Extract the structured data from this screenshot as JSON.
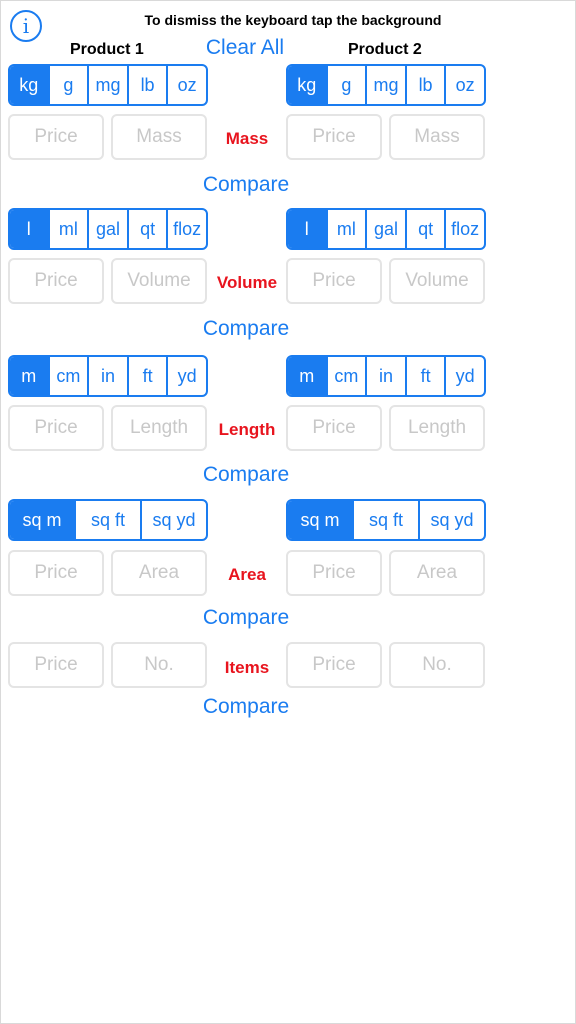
{
  "header": {
    "info_icon_glyph": "i",
    "hint": "To dismiss the keyboard tap the background",
    "product1": "Product 1",
    "product2": "Product 2",
    "clear_all": "Clear All"
  },
  "sections": {
    "mass": {
      "label": "Mass",
      "units": [
        "kg",
        "g",
        "mg",
        "lb",
        "oz"
      ],
      "selected": "kg",
      "price_placeholder": "Price",
      "qty_placeholder": "Mass",
      "compare": "Compare"
    },
    "volume": {
      "label": "Volume",
      "units": [
        "l",
        "ml",
        "gal",
        "qt",
        "floz"
      ],
      "selected": "l",
      "price_placeholder": "Price",
      "qty_placeholder": "Volume",
      "compare": "Compare"
    },
    "length": {
      "label": "Length",
      "units": [
        "m",
        "cm",
        "in",
        "ft",
        "yd"
      ],
      "selected": "m",
      "price_placeholder": "Price",
      "qty_placeholder": "Length",
      "compare": "Compare"
    },
    "area": {
      "label": "Area",
      "units": [
        "sq m",
        "sq ft",
        "sq yd"
      ],
      "selected": "sq m",
      "price_placeholder": "Price",
      "qty_placeholder": "Area",
      "compare": "Compare"
    },
    "items": {
      "label": "Items",
      "price_placeholder": "Price",
      "qty_placeholder": "No.",
      "compare": "Compare"
    }
  },
  "colors": {
    "accent": "#1a7cf0",
    "category": "#e8141e",
    "placeholder": "#c8c8c8"
  }
}
